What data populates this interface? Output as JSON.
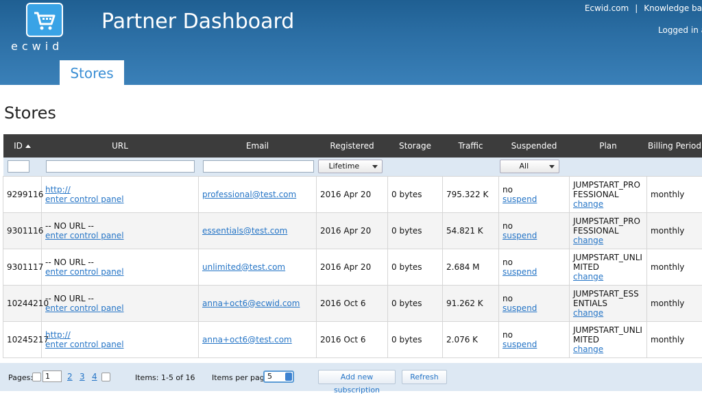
{
  "header": {
    "logo_text": "ecwid",
    "app_title": "Partner Dashboard",
    "top_links": [
      "Ecwid.com",
      "Knowledge ba"
    ],
    "separator": "|",
    "logged_in": "Logged in a",
    "nav_tab": "Stores"
  },
  "page": {
    "title": "Stores"
  },
  "table": {
    "columns": [
      "ID",
      "URL",
      "Email",
      "Registered",
      "Storage",
      "Traffic",
      "Suspended",
      "Plan",
      "Billing Period"
    ],
    "filters": {
      "registered": "Lifetime",
      "suspended": "All"
    },
    "rows": [
      {
        "id": "9299116",
        "url": "http://",
        "url_is_link": true,
        "panel": "enter control panel",
        "email": "professional@test.com",
        "registered": "2016 Apr 20",
        "storage": "0 bytes",
        "traffic": "795.322 K",
        "suspended": "no",
        "suspend_link": "suspend",
        "plan": "JUMPSTART_PROFESSIONAL",
        "change_link": "change",
        "billing": "monthly"
      },
      {
        "id": "9301116",
        "url": "-- NO URL --",
        "url_is_link": false,
        "panel": "enter control panel",
        "email": "essentials@test.com",
        "registered": "2016 Apr 20",
        "storage": "0 bytes",
        "traffic": "54.821 K",
        "suspended": "no",
        "suspend_link": "suspend",
        "plan": "JUMPSTART_PROFESSIONAL",
        "change_link": "change",
        "billing": "monthly"
      },
      {
        "id": "9301117",
        "url": "-- NO URL --",
        "url_is_link": false,
        "panel": "enter control panel",
        "email": "unlimited@test.com",
        "registered": "2016 Apr 20",
        "storage": "0 bytes",
        "traffic": "2.684 M",
        "suspended": "no",
        "suspend_link": "suspend",
        "plan": "JUMPSTART_UNLIMITED",
        "change_link": "change",
        "billing": "monthly"
      },
      {
        "id": "10244210",
        "url": "-- NO URL --",
        "url_is_link": false,
        "panel": "enter control panel",
        "email": "anna+oct6@ecwid.com",
        "registered": "2016 Oct 6",
        "storage": "0 bytes",
        "traffic": "91.262 K",
        "suspended": "no",
        "suspend_link": "suspend",
        "plan": "JUMPSTART_ESSENTIALS",
        "change_link": "change",
        "billing": "monthly"
      },
      {
        "id": "10245217",
        "url": "http://",
        "url_is_link": true,
        "panel": "enter control panel",
        "email": "anna+oct6@test.com",
        "registered": "2016 Oct 6",
        "storage": "0 bytes",
        "traffic": "2.076 K",
        "suspended": "no",
        "suspend_link": "suspend",
        "plan": "JUMPSTART_UNLIMITED",
        "change_link": "change",
        "billing": "monthly"
      }
    ]
  },
  "footer": {
    "pages_label": "Pages:",
    "current_page": "1",
    "page_links": [
      "2",
      "3",
      "4"
    ],
    "items_info": "Items: 1-5 of 16",
    "items_per_page_label": "Items per page",
    "items_per_page": "5",
    "add_button": "Add new subscription",
    "refresh_button": "Refresh"
  },
  "colors": {
    "header_top": "#1f5f92",
    "header_bottom": "#3a80b8",
    "link": "#2474c6",
    "table_header": "#3c3c3c",
    "filter_row": "#dde8f3",
    "logo": "#39a3e6"
  }
}
